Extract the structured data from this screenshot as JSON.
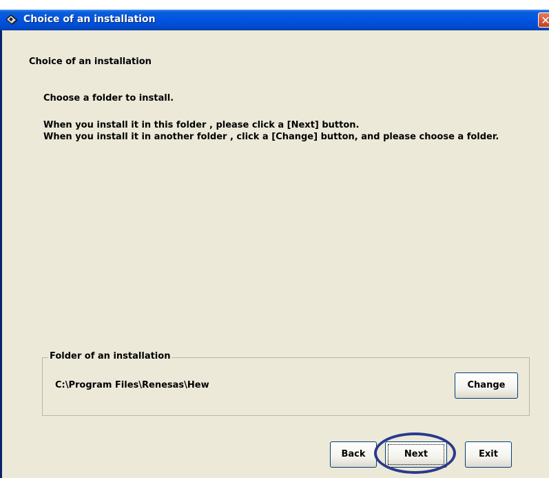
{
  "window": {
    "title": "Choice of an installation",
    "icon": "installer-icon",
    "close_glyph": "✕"
  },
  "content": {
    "heading": "Choice of an installation",
    "instruction": "Choose a folder to install.",
    "line_next": "When you install it in this folder , please click a [Next] button.",
    "line_change": "When you install it in another folder , click a [Change] button, and please choose a folder."
  },
  "folder_group": {
    "label": "Folder of an installation",
    "path": "C:\\Program Files\\Renesas\\Hew",
    "change_label": "Change"
  },
  "buttons": {
    "back": "Back",
    "next": "Next",
    "exit": "Exit"
  },
  "colors": {
    "titlebar": "#0054e3",
    "face": "#ece9d8",
    "highlight_ring": "#2a3a8c",
    "close": "#c2401f"
  }
}
